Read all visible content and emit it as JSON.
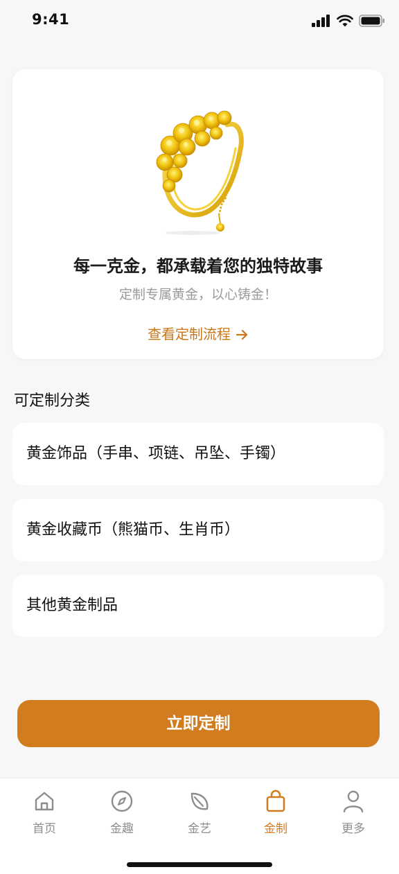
{
  "status_bar": {
    "time": "9:41",
    "icons": [
      "signal-icon",
      "wifi-icon",
      "battery-icon"
    ]
  },
  "hero": {
    "image": "gold-bracelet-image",
    "headline": "每一克金，都承载着您的独特故事",
    "subtitle": "定制专属黄金，以心铸金！",
    "link_label": "查看定制流程",
    "link_icon": "arrow-right-icon"
  },
  "categories": {
    "title": "可定制分类",
    "items": [
      {
        "label": "黄金饰品（手串、项链、吊坠、手镯）"
      },
      {
        "label": "黄金收藏币（熊猫币、生肖币）"
      },
      {
        "label": "其他黄金制品"
      }
    ]
  },
  "primary_button": {
    "label": "立即定制"
  },
  "tabs": [
    {
      "label": "首页",
      "icon": "home-icon"
    },
    {
      "label": "金趣",
      "icon": "compass-icon"
    },
    {
      "label": "金艺",
      "icon": "leaf-icon"
    },
    {
      "label": "金制",
      "icon": "shopping-bag-icon",
      "active": true
    },
    {
      "label": "更多",
      "icon": "person-icon"
    }
  ],
  "colors": {
    "accent": "#d07c1f",
    "link": "#c97718",
    "background": "#f7f7f7",
    "card": "#ffffff",
    "inactive_tab": "#8d8d8d",
    "gold": "#e8b60e"
  }
}
